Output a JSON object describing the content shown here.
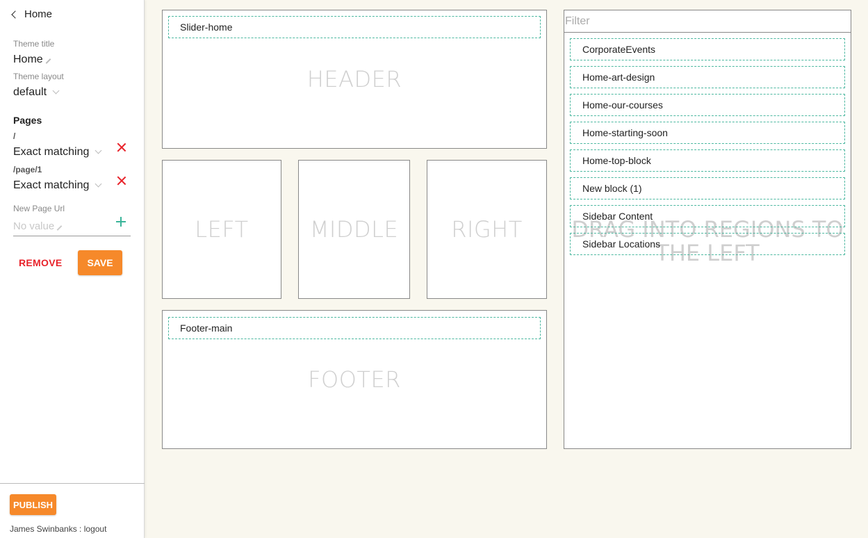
{
  "sidebar": {
    "back_label": "Home",
    "theme_title_label": "Theme title",
    "theme_title_value": "Home",
    "theme_layout_label": "Theme layout",
    "theme_layout_value": "default",
    "pages_heading": "Pages",
    "pages": [
      {
        "path": "/",
        "matching": "Exact matching"
      },
      {
        "path": "/page/1",
        "matching": "Exact matching"
      }
    ],
    "new_page_url_label": "New Page Url",
    "new_page_url_placeholder": "No value",
    "remove_label": "REMOVE",
    "save_label": "SAVE",
    "publish_label": "PUBLISH",
    "user_name": "James Swinbanks",
    "separator": " : ",
    "logout_label": "logout"
  },
  "regions": {
    "header": {
      "label": "HEADER",
      "blocks": [
        "Slider-home"
      ]
    },
    "left": {
      "label": "LEFT"
    },
    "middle": {
      "label": "MIDDLE"
    },
    "right": {
      "label": "RIGHT"
    },
    "footer": {
      "label": "FOOTER",
      "blocks": [
        "Footer-main"
      ]
    }
  },
  "blocks_panel": {
    "filter_placeholder": "Filter",
    "drag_hint_line1": "DRAG INTO REGIONS TO",
    "drag_hint_line2": "THE LEFT",
    "items": [
      "CorporateEvents",
      "Home-art-design",
      "Home-our-courses",
      "Home-starting-soon",
      "Home-top-block",
      "New block (1)",
      "Sidebar Content",
      "Sidebar Locations"
    ]
  },
  "colors": {
    "accent": "#f6892a",
    "danger": "#e8232b",
    "add": "#3ab499",
    "block_border": "#4cb8a0",
    "canvas_bg": "#f9f7ee"
  },
  "icons": [
    "chevron-left-icon",
    "pencil-icon",
    "chevron-down-icon",
    "close-icon",
    "plus-icon"
  ]
}
